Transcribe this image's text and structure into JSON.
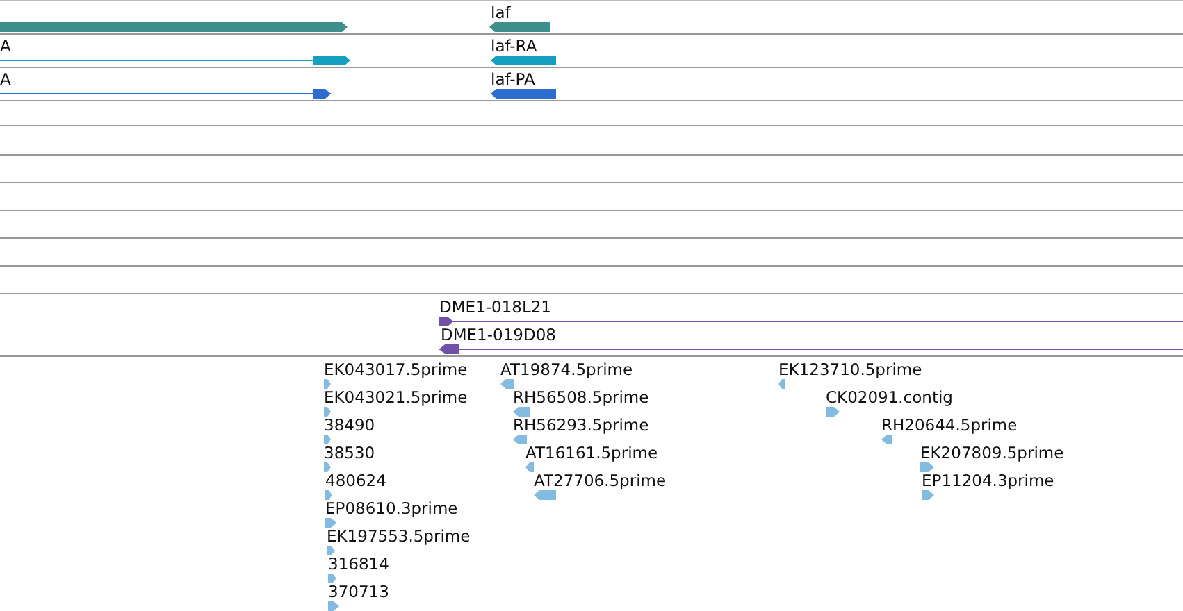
{
  "tracks": [
    {
      "kind": "gene",
      "color": "#3f8f8f",
      "features": [
        {
          "kind": "forward"
        },
        {
          "label": "laf",
          "kind": "reverse"
        }
      ]
    },
    {
      "kind": "transcript",
      "color": "#169fbf",
      "features": [
        {
          "label": "A",
          "kind": "forward"
        },
        {
          "label": "laf-RA",
          "kind": "reverse"
        }
      ]
    },
    {
      "kind": "protein",
      "color": "#2f6ccf",
      "features": [
        {
          "label": "A",
          "kind": "forward"
        },
        {
          "label": "laf-PA",
          "kind": "reverse"
        }
      ]
    },
    {
      "kind": "empty"
    },
    {
      "kind": "empty"
    },
    {
      "kind": "empty"
    },
    {
      "kind": "empty"
    },
    {
      "kind": "empty"
    },
    {
      "kind": "empty"
    },
    {
      "kind": "empty"
    },
    {
      "kind": "clone",
      "color": "#7050a8",
      "features": [
        {
          "label": "DME1-018L21",
          "kind": "forward"
        },
        {
          "label": "DME1-019D08",
          "kind": "reverse"
        }
      ]
    },
    {
      "kind": "est",
      "color": "#84bbe0",
      "features": [
        {
          "label": "EK043017.5prime",
          "kind": "forward"
        },
        {
          "label": "EK043021.5prime",
          "kind": "forward"
        },
        {
          "label": "38490",
          "kind": "forward"
        },
        {
          "label": "38530",
          "kind": "forward"
        },
        {
          "label": "480624",
          "kind": "forward"
        },
        {
          "label": "EP08610.3prime",
          "kind": "forward"
        },
        {
          "label": "EK197553.5prime",
          "kind": "forward"
        },
        {
          "label": "316814",
          "kind": "forward"
        },
        {
          "label": "370713",
          "kind": "forward"
        },
        {
          "label": "AT19874.5prime",
          "kind": "reverse"
        },
        {
          "label": "RH56508.5prime",
          "kind": "reverse"
        },
        {
          "label": "RH56293.5prime",
          "kind": "reverse"
        },
        {
          "label": "AT16161.5prime",
          "kind": "reverse"
        },
        {
          "label": "AT27706.5prime",
          "kind": "reverse"
        },
        {
          "label": "EK123710.5prime",
          "kind": "reverse"
        },
        {
          "label": "CK02091.contig",
          "kind": "forward"
        },
        {
          "label": "RH20644.5prime",
          "kind": "reverse"
        },
        {
          "label": "EK207809.5prime",
          "kind": "forward"
        },
        {
          "label": "EP11204.3prime",
          "kind": "forward"
        }
      ]
    }
  ]
}
